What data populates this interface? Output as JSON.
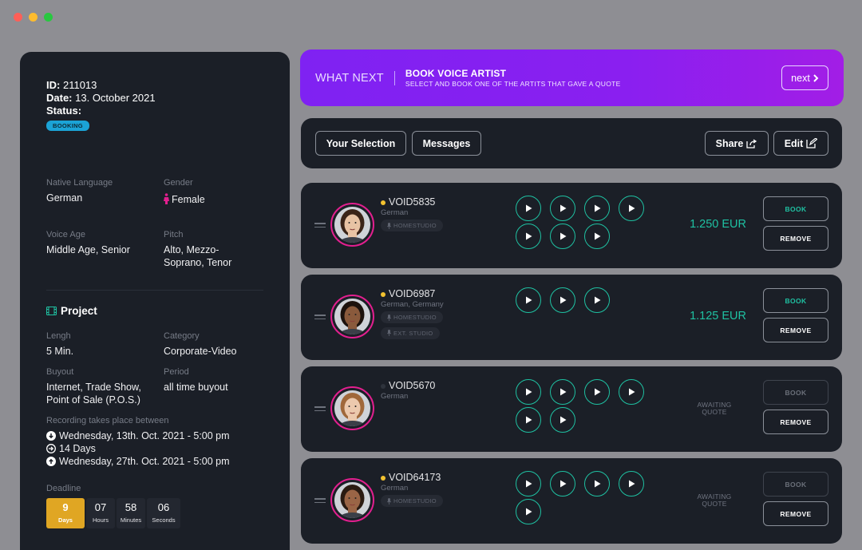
{
  "window": {
    "dots": [
      "#ff5f57",
      "#febc2e",
      "#28c840"
    ]
  },
  "order": {
    "id_label": "ID:",
    "id": "211013",
    "date_label": "Date:",
    "date": "13. October 2021",
    "status_label": "Status:",
    "status": "BOOKING"
  },
  "details": {
    "native_language": {
      "label": "Native Language",
      "value": "German"
    },
    "gender": {
      "label": "Gender",
      "value": "Female"
    },
    "voice_age": {
      "label": "Voice Age",
      "value": "Middle Age, Senior"
    },
    "pitch": {
      "label": "Pitch",
      "value": "Alto, Mezzo-Soprano, Tenor"
    }
  },
  "project": {
    "title": "Project",
    "length": {
      "label": "Lengh",
      "value": "5 Min."
    },
    "category": {
      "label": "Category",
      "value": "Corporate-Video"
    },
    "buyout": {
      "label": "Buyout",
      "value": "Internet, Trade Show, Point of Sale (P.O.S.)"
    },
    "period": {
      "label": "Period",
      "value": "all time buyout"
    },
    "recording_label": "Recording takes place between",
    "recording_start": "Wednesday, 13th. Oct. 2021 - 5:00 pm",
    "recording_duration": "14 Days",
    "recording_end": "Wednesday, 27th. Oct. 2021 - 5:00 pm",
    "deadline_label": "Deadline",
    "countdown": [
      {
        "num": "9",
        "unit": "Days"
      },
      {
        "num": "07",
        "unit": "Hours"
      },
      {
        "num": "58",
        "unit": "Minutes"
      },
      {
        "num": "06",
        "unit": "Seconds"
      }
    ]
  },
  "banner": {
    "what_next": "WHAT NEXT",
    "title": "BOOK VOICE ARTIST",
    "subtitle": "SELECT AND BOOK ONE OF THE ARTITS THAT GAVE A QUOTE",
    "next_label": "next"
  },
  "toolbar": {
    "your_selection": "Your Selection",
    "messages": "Messages",
    "share": "Share",
    "edit": "Edit"
  },
  "artists": [
    {
      "name": "VOID5835",
      "language": "German",
      "tags": [
        "HOMESTUDIO"
      ],
      "status_color": "#f2c230",
      "samples": 7,
      "price": "1.250 EUR",
      "book": "BOOK",
      "remove": "REMOVE",
      "bookable": true
    },
    {
      "name": "VOID6987",
      "language": "German, Germany",
      "tags": [
        "HOMESTUDIO",
        "EXT. STUDIO"
      ],
      "status_color": "#f2c230",
      "samples": 3,
      "price": "1.125 EUR",
      "book": "BOOK",
      "remove": "REMOVE",
      "bookable": true
    },
    {
      "name": "VOID5670",
      "language": "German",
      "tags": [],
      "status_color": "#2e333c",
      "samples": 6,
      "price": "AWAITING QUOTE",
      "book": "BOOK",
      "remove": "REMOVE",
      "bookable": false
    },
    {
      "name": "VOID64173",
      "language": "German",
      "tags": [
        "HOMESTUDIO"
      ],
      "status_color": "#f2c230",
      "samples": 5,
      "price": "AWAITING QUOTE",
      "book": "BOOK",
      "remove": "REMOVE",
      "bookable": false
    }
  ]
}
